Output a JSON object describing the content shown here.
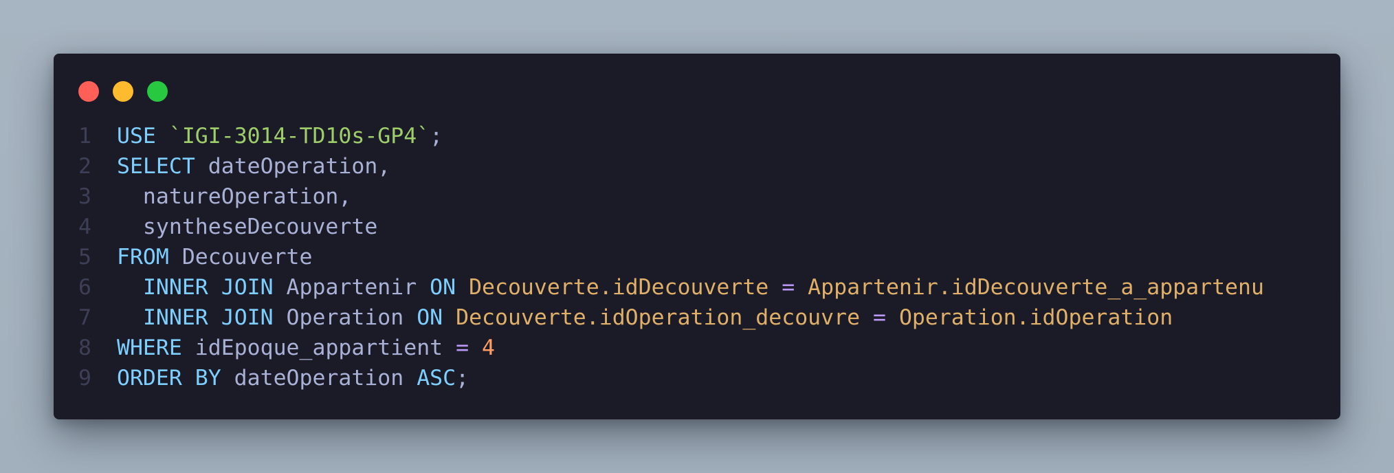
{
  "window": {
    "controls": {
      "close_color": "#fe5f57",
      "minimize_color": "#febb2e",
      "maximize_color": "#28c840"
    }
  },
  "theme": {
    "background": "#1b1b27",
    "keyword": "#7dcfff",
    "string": "#9ece6a",
    "identifier": "#a9b1d6",
    "column": "#e0af68",
    "operator": "#bb9af7",
    "number": "#ff9e64",
    "line_number": "#3c3f55"
  },
  "code": {
    "language": "SQL",
    "lines": [
      {
        "n": "1",
        "tokens": [
          {
            "t": "USE",
            "k": "kw"
          },
          {
            "t": " ",
            "k": "pun"
          },
          {
            "t": "`IGI-3014-TD10s-GP4`",
            "k": "str"
          },
          {
            "t": ";",
            "k": "pun"
          }
        ]
      },
      {
        "n": "2",
        "tokens": [
          {
            "t": "SELECT",
            "k": "kw"
          },
          {
            "t": " dateOperation,",
            "k": "id"
          }
        ]
      },
      {
        "n": "3",
        "tokens": [
          {
            "t": "  natureOperation,",
            "k": "id"
          }
        ]
      },
      {
        "n": "4",
        "tokens": [
          {
            "t": "  syntheseDecouverte",
            "k": "id"
          }
        ]
      },
      {
        "n": "5",
        "tokens": [
          {
            "t": "FROM",
            "k": "kw"
          },
          {
            "t": " Decouverte",
            "k": "id"
          }
        ]
      },
      {
        "n": "6",
        "tokens": [
          {
            "t": "  ",
            "k": "pun"
          },
          {
            "t": "INNER JOIN",
            "k": "kw"
          },
          {
            "t": " Appartenir ",
            "k": "id"
          },
          {
            "t": "ON",
            "k": "kw"
          },
          {
            "t": " ",
            "k": "pun"
          },
          {
            "t": "Decouverte.idDecouverte",
            "k": "col"
          },
          {
            "t": " = ",
            "k": "op"
          },
          {
            "t": "Appartenir.idDecouverte_a_appartenu",
            "k": "col"
          }
        ]
      },
      {
        "n": "7",
        "tokens": [
          {
            "t": "  ",
            "k": "pun"
          },
          {
            "t": "INNER JOIN",
            "k": "kw"
          },
          {
            "t": " Operation ",
            "k": "id"
          },
          {
            "t": "ON",
            "k": "kw"
          },
          {
            "t": " ",
            "k": "pun"
          },
          {
            "t": "Decouverte.idOperation_decouvre",
            "k": "col"
          },
          {
            "t": " = ",
            "k": "op"
          },
          {
            "t": "Operation.idOperation",
            "k": "col"
          }
        ]
      },
      {
        "n": "8",
        "tokens": [
          {
            "t": "WHERE",
            "k": "kw"
          },
          {
            "t": " idEpoque_appartient ",
            "k": "id"
          },
          {
            "t": "=",
            "k": "op"
          },
          {
            "t": " ",
            "k": "pun"
          },
          {
            "t": "4",
            "k": "num"
          }
        ]
      },
      {
        "n": "9",
        "tokens": [
          {
            "t": "ORDER BY",
            "k": "kw"
          },
          {
            "t": " dateOperation ",
            "k": "id"
          },
          {
            "t": "ASC",
            "k": "kw"
          },
          {
            "t": ";",
            "k": "pun"
          }
        ]
      }
    ]
  }
}
